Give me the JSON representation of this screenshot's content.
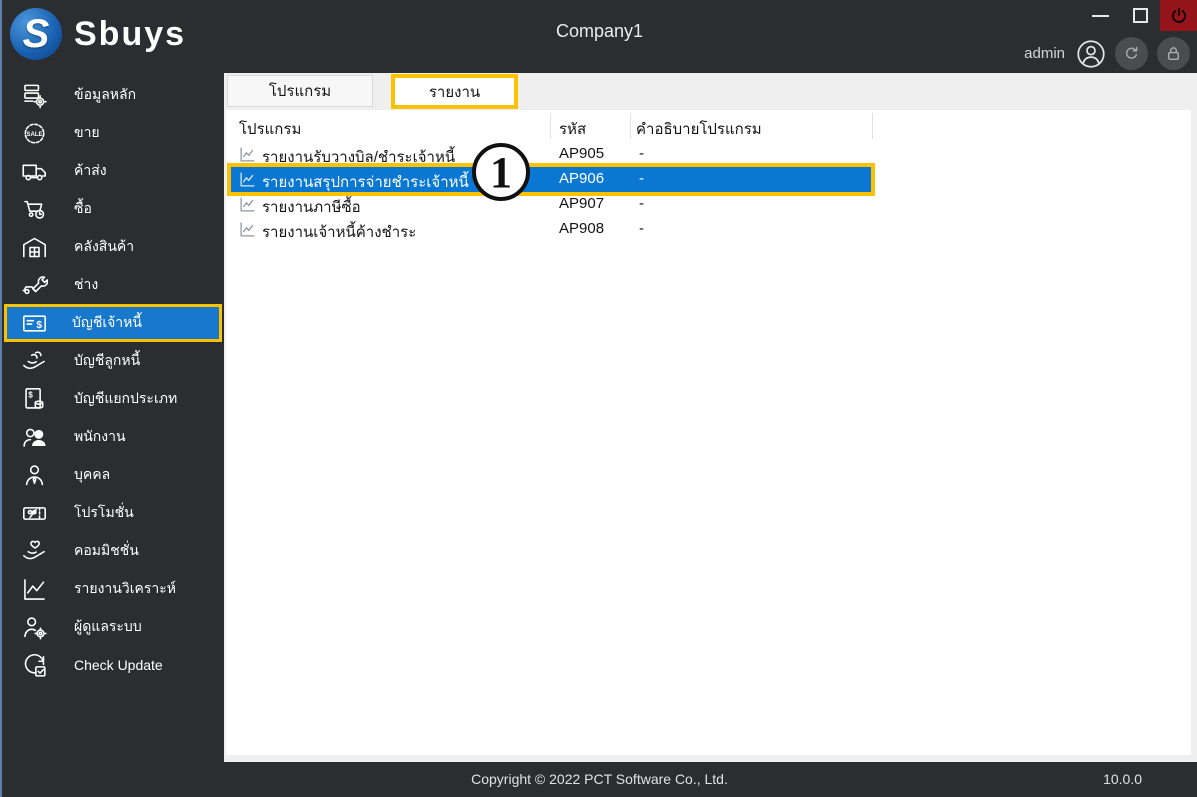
{
  "brand": {
    "name": "Sbuys",
    "logo_letter": "S"
  },
  "titlebar": {
    "title": "Company1",
    "user": "admin"
  },
  "sidebar": {
    "items": [
      {
        "label": "ข้อมูลหลัก",
        "icon": "master-data-icon",
        "selected": false
      },
      {
        "label": "ขาย",
        "icon": "sale-badge-icon",
        "selected": false
      },
      {
        "label": "ค้าส่ง",
        "icon": "delivery-truck-icon",
        "selected": false
      },
      {
        "label": "ซื้อ",
        "icon": "purchase-cart-icon",
        "selected": false
      },
      {
        "label": "คลังสินค้า",
        "icon": "warehouse-icon",
        "selected": false
      },
      {
        "label": "ช่าง",
        "icon": "mechanic-icon",
        "selected": false
      },
      {
        "label": "บัญชีเจ้าหนี้",
        "icon": "accounts-payable-icon",
        "selected": true,
        "highlighted": true
      },
      {
        "label": "บัญชีลูกหนี้",
        "icon": "accounts-receivable-icon",
        "selected": false
      },
      {
        "label": "บัญชีแยกประเภท",
        "icon": "general-ledger-icon",
        "selected": false
      },
      {
        "label": "พนักงาน",
        "icon": "employees-icon",
        "selected": false
      },
      {
        "label": "บุคคล",
        "icon": "person-icon",
        "selected": false
      },
      {
        "label": "โปรโมชั่น",
        "icon": "promotion-icon",
        "selected": false
      },
      {
        "label": "คอมมิชชั่น",
        "icon": "commission-icon",
        "selected": false
      },
      {
        "label": "รายงานวิเคราะห์",
        "icon": "analytics-chart-icon",
        "selected": false
      },
      {
        "label": "ผู้ดูแลระบบ",
        "icon": "system-admin-icon",
        "selected": false
      },
      {
        "label": "Check Update",
        "icon": "check-update-icon",
        "selected": false
      }
    ]
  },
  "tabs": [
    {
      "label": "โปรแกรม",
      "active": false,
      "highlighted": false
    },
    {
      "label": "รายงาน",
      "active": true,
      "highlighted": true
    }
  ],
  "table": {
    "columns": [
      "โปรแกรม",
      "รหัส",
      "คำอธิบายโปรแกรม"
    ],
    "rows": [
      {
        "name": "รายงานรับวางบิล/ชำระเจ้าหนี้",
        "code": "AP905",
        "description": "-",
        "selected": false
      },
      {
        "name": "รายงานสรุปการจ่ายชำระเจ้าหนี้",
        "code": "AP906",
        "description": "-",
        "selected": true,
        "highlighted": true
      },
      {
        "name": "รายงานภาษีซื้อ",
        "code": "AP907",
        "description": "-",
        "selected": false
      },
      {
        "name": "รายงานเจ้าหนี้ค้างชำระ",
        "code": "AP908",
        "description": "-",
        "selected": false
      }
    ]
  },
  "annotation": {
    "step_number": "1"
  },
  "footer": {
    "copyright": "Copyright © 2022 PCT Software Co., Ltd.",
    "version": "10.0.0"
  },
  "colors": {
    "titlebar_dark": "#2b2d30",
    "accent_yellow": "#fcc200",
    "row_selection_blue": "#0a78d2",
    "sidebar_selection_blue": "#1878cc",
    "power_red": "#951419",
    "window_border_blue": "#5b7fa8",
    "panel_white": "#ffffff",
    "main_gray": "#efefef"
  }
}
